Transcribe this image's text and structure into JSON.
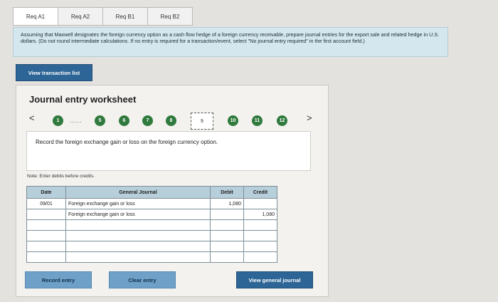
{
  "tabs": [
    {
      "label": "Req A1"
    },
    {
      "label": "Req A2"
    },
    {
      "label": "Req B1"
    },
    {
      "label": "Req B2"
    }
  ],
  "instructions": "Assuming that Maxwell designates the foreign currency option as a cash flow hedge of a foreign currency receivable, prepare journal entries for the export sale and related hedge in U.S. dollars. (Do not round intermediate calculations. If no entry is required for a transaction/event, select \"No journal entry required\" in the first account field.)",
  "view_transaction_button": "View transaction list",
  "worksheet": {
    "title": "Journal entry worksheet",
    "nav_prev": "<",
    "nav_next": ">",
    "ellipsis": ".....",
    "steps": [
      "1",
      "5",
      "6",
      "7",
      "8",
      "9",
      "10",
      "11",
      "12"
    ],
    "current_step": "9",
    "description": "Record the foreign exchange gain or loss on the foreign currency option.",
    "note": "Note: Enter debits before credits."
  },
  "journal": {
    "headers": {
      "date": "Date",
      "general_journal": "General Journal",
      "debit": "Debit",
      "credit": "Credit"
    },
    "rows": [
      {
        "date": "09/01",
        "account": "Foreign exchange gain or loss",
        "debit": "1,080",
        "credit": ""
      },
      {
        "date": "",
        "account": "Foreign exchange gain or loss",
        "debit": "",
        "credit": "1,080"
      },
      {
        "date": "",
        "account": "",
        "debit": "",
        "credit": ""
      },
      {
        "date": "",
        "account": "",
        "debit": "",
        "credit": ""
      },
      {
        "date": "",
        "account": "",
        "debit": "",
        "credit": ""
      },
      {
        "date": "",
        "account": "",
        "debit": "",
        "credit": ""
      }
    ]
  },
  "buttons": {
    "record": "Record entry",
    "clear": "Clear entry",
    "view_general": "View general journal"
  },
  "colors": {
    "accent_dark": "#2c6596",
    "accent_light": "#6fa0c8",
    "step_green": "#2f7a3c",
    "instruction_bg": "#d5e7ee",
    "table_header": "#b7cfda"
  }
}
